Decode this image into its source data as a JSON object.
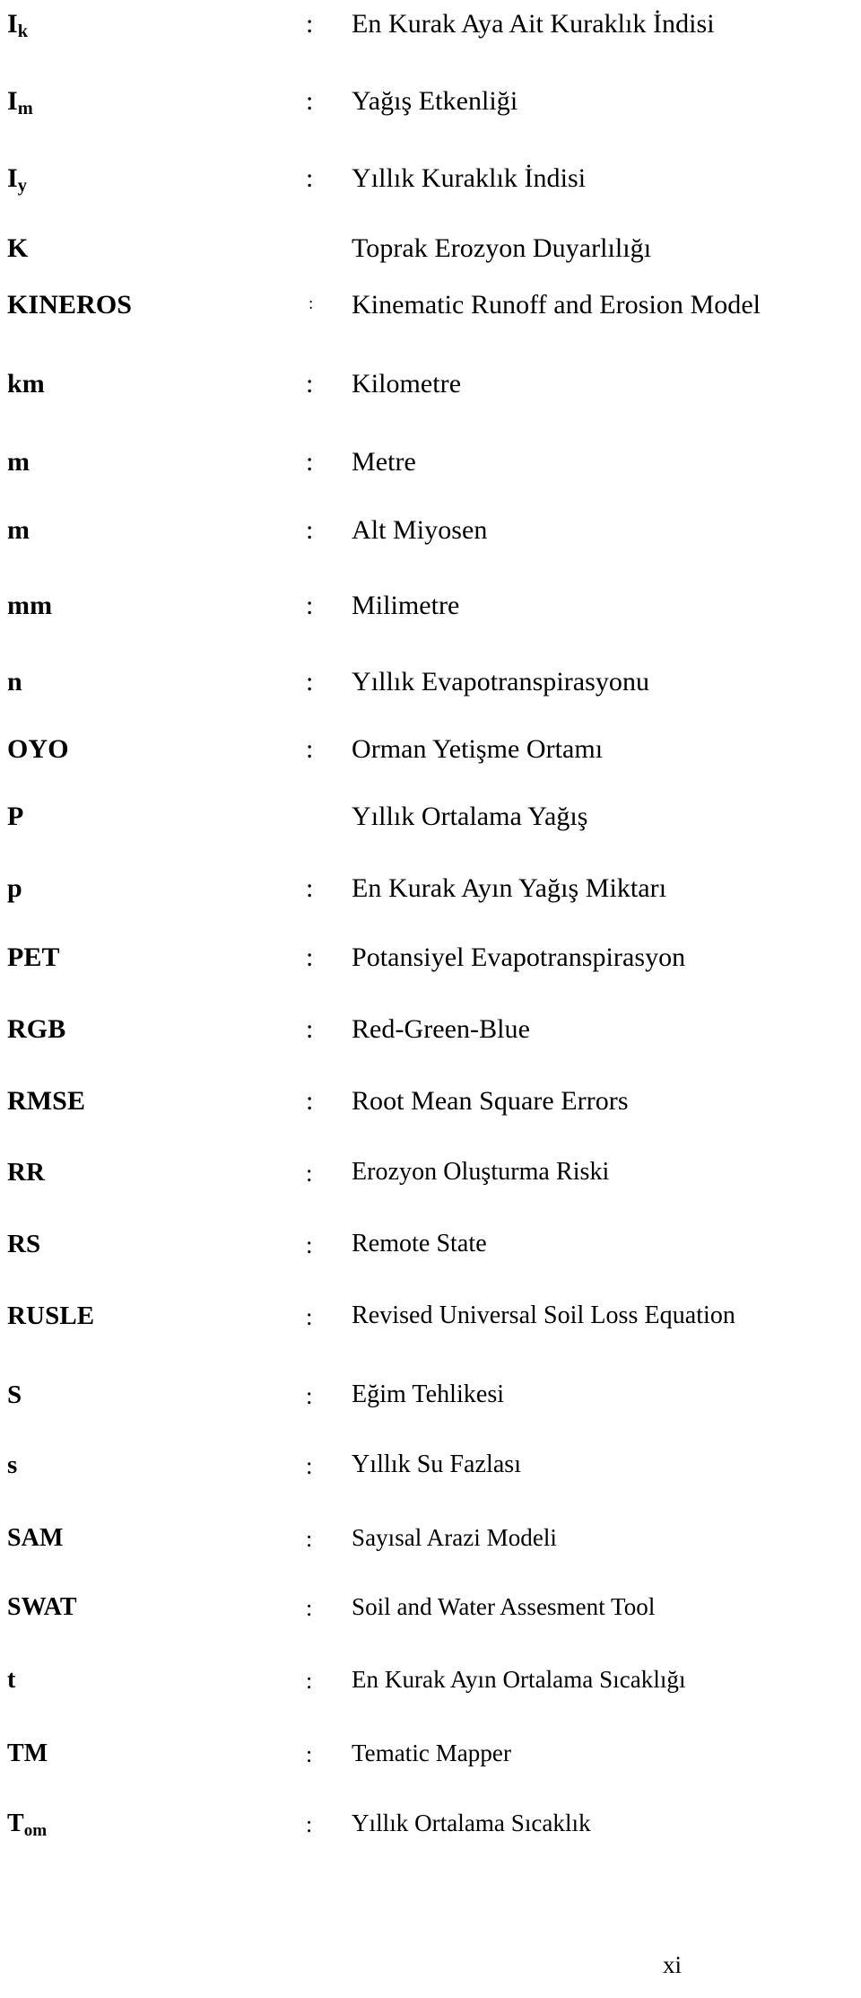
{
  "document": {
    "type": "symbols-and-abbreviations-list",
    "page_number": "xi",
    "column_headers_visible": false
  },
  "separator": {
    "colon": ":"
  },
  "entries": [
    {
      "symbol_base": "I",
      "symbol_sub": "k",
      "symbol_plain": "Ik",
      "colon": ":",
      "has_colon": true,
      "definition": "En Kurak Aya Ait Kuraklık İndisi"
    },
    {
      "symbol_base": "I",
      "symbol_sub": "m",
      "symbol_plain": "Im",
      "colon": ":",
      "has_colon": true,
      "definition": "Yağış Etkenliği"
    },
    {
      "symbol_base": "I",
      "symbol_sub": "y",
      "symbol_plain": "Iy",
      "colon": ":",
      "has_colon": true,
      "definition": "Yıllık Kuraklık İndisi"
    },
    {
      "symbol_base": "K",
      "symbol_sub": "",
      "symbol_plain": "K",
      "colon": "",
      "has_colon": false,
      "definition": "Toprak Erozyon Duyarlılığı"
    },
    {
      "symbol_base": "KINEROS",
      "symbol_sub": "",
      "symbol_plain": "KINEROS",
      "colon": ":",
      "has_colon": true,
      "definition": "Kinematic Runoff and Erosion Model"
    },
    {
      "symbol_base": "km",
      "symbol_sub": "",
      "symbol_plain": "km",
      "colon": ":",
      "has_colon": true,
      "definition": "Kilometre"
    },
    {
      "symbol_base": "m",
      "symbol_sub": "",
      "symbol_plain": "m",
      "colon": ":",
      "has_colon": true,
      "definition": "Metre"
    },
    {
      "symbol_base": "m",
      "symbol_sub": "",
      "symbol_plain": "m",
      "colon": ":",
      "has_colon": true,
      "definition": "Alt Miyosen"
    },
    {
      "symbol_base": "mm",
      "symbol_sub": "",
      "symbol_plain": "mm",
      "colon": ":",
      "has_colon": true,
      "definition": "Milimetre"
    },
    {
      "symbol_base": "n",
      "symbol_sub": "",
      "symbol_plain": "n",
      "colon": ":",
      "has_colon": true,
      "definition": "Yıllık Evapotranspirasyonu"
    },
    {
      "symbol_base": "OYO",
      "symbol_sub": "",
      "symbol_plain": "OYO",
      "colon": ":",
      "has_colon": true,
      "definition": "Orman Yetişme Ortamı"
    },
    {
      "symbol_base": "P",
      "symbol_sub": "",
      "symbol_plain": "P",
      "colon": "",
      "has_colon": false,
      "definition": "Yıllık Ortalama Yağış"
    },
    {
      "symbol_base": "p",
      "symbol_sub": "",
      "symbol_plain": "p",
      "colon": ":",
      "has_colon": true,
      "definition": "En Kurak Ayın Yağış Miktarı"
    },
    {
      "symbol_base": "PET",
      "symbol_sub": "",
      "symbol_plain": "PET",
      "colon": ":",
      "has_colon": true,
      "definition": "Potansiyel Evapotranspirasyon"
    },
    {
      "symbol_base": "RGB",
      "symbol_sub": "",
      "symbol_plain": "RGB",
      "colon": ":",
      "has_colon": true,
      "definition": "Red-Green-Blue"
    },
    {
      "symbol_base": "RMSE",
      "symbol_sub": "",
      "symbol_plain": "RMSE",
      "colon": ":",
      "has_colon": true,
      "definition": "Root Mean Square Errors"
    },
    {
      "symbol_base": "RR",
      "symbol_sub": "",
      "symbol_plain": "RR",
      "colon": ":",
      "has_colon": true,
      "definition": "Erozyon Oluşturma Riski"
    },
    {
      "symbol_base": "RS",
      "symbol_sub": "",
      "symbol_plain": "RS",
      "colon": ":",
      "has_colon": true,
      "definition": "Remote State"
    },
    {
      "symbol_base": "RUSLE",
      "symbol_sub": "",
      "symbol_plain": "RUSLE",
      "colon": ":",
      "has_colon": true,
      "definition": "Revised Universal Soil Loss Equation"
    },
    {
      "symbol_base": "S",
      "symbol_sub": "",
      "symbol_plain": "S",
      "colon": ":",
      "has_colon": true,
      "definition": "Eğim Tehlikesi"
    },
    {
      "symbol_base": "s",
      "symbol_sub": "",
      "symbol_plain": "s",
      "colon": ":",
      "has_colon": true,
      "definition": "Yıllık Su Fazlası"
    },
    {
      "symbol_base": "SAM",
      "symbol_sub": "",
      "symbol_plain": "SAM",
      "colon": ":",
      "has_colon": true,
      "definition": "Sayısal Arazi Modeli"
    },
    {
      "symbol_base": "SWAT",
      "symbol_sub": "",
      "symbol_plain": "SWAT",
      "colon": ":",
      "has_colon": true,
      "definition": "Soil and Water Assesment Tool"
    },
    {
      "symbol_base": "t",
      "symbol_sub": "",
      "symbol_plain": "t",
      "colon": ":",
      "has_colon": true,
      "definition": "En Kurak Ayın Ortalama Sıcaklığı"
    },
    {
      "symbol_base": "TM",
      "symbol_sub": "",
      "symbol_plain": "TM",
      "colon": ":",
      "has_colon": true,
      "definition": "Tematic Mapper"
    },
    {
      "symbol_base": "T",
      "symbol_sub": "om",
      "symbol_plain": "Tom",
      "colon": ":",
      "has_colon": true,
      "definition": "Yıllık Ortalama Sıcaklık"
    }
  ]
}
